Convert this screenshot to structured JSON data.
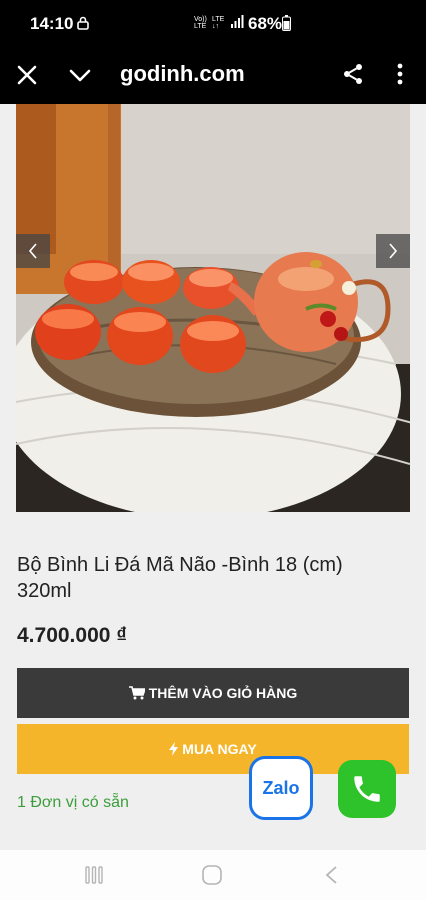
{
  "status": {
    "time": "14:10",
    "net_line1": "Vo))",
    "net_line2": "LTE",
    "net2_line1": "LTE",
    "net2_line2": "↓↑",
    "battery": "68%"
  },
  "browser": {
    "url": "godinh.com"
  },
  "product": {
    "title": "Bộ Bình Li Đá Mã Não -Bình 18 (cm) 320ml",
    "price": "4.700.000 ₫",
    "add_to_cart_label": "THÊM VÀO GIỎ HÀNG",
    "buy_now_label": "MUA NGAY",
    "stock_text": "1 Đơn vị có sẵn"
  },
  "contact": {
    "zalo_label": "Zalo"
  },
  "icons": {
    "lock": "lock-icon",
    "close": "close-icon",
    "chevron": "chevron-down-icon",
    "share": "share-icon",
    "more": "more-vertical-icon",
    "cart": "cart-icon",
    "bolt": "bolt-icon",
    "phone": "phone-icon"
  },
  "colors": {
    "buy_button": "#f4b52a",
    "cart_button": "#3a3a3a",
    "stock_text": "#3c9d3c",
    "zalo": "#1a74e8",
    "phone": "#2ec32a"
  }
}
